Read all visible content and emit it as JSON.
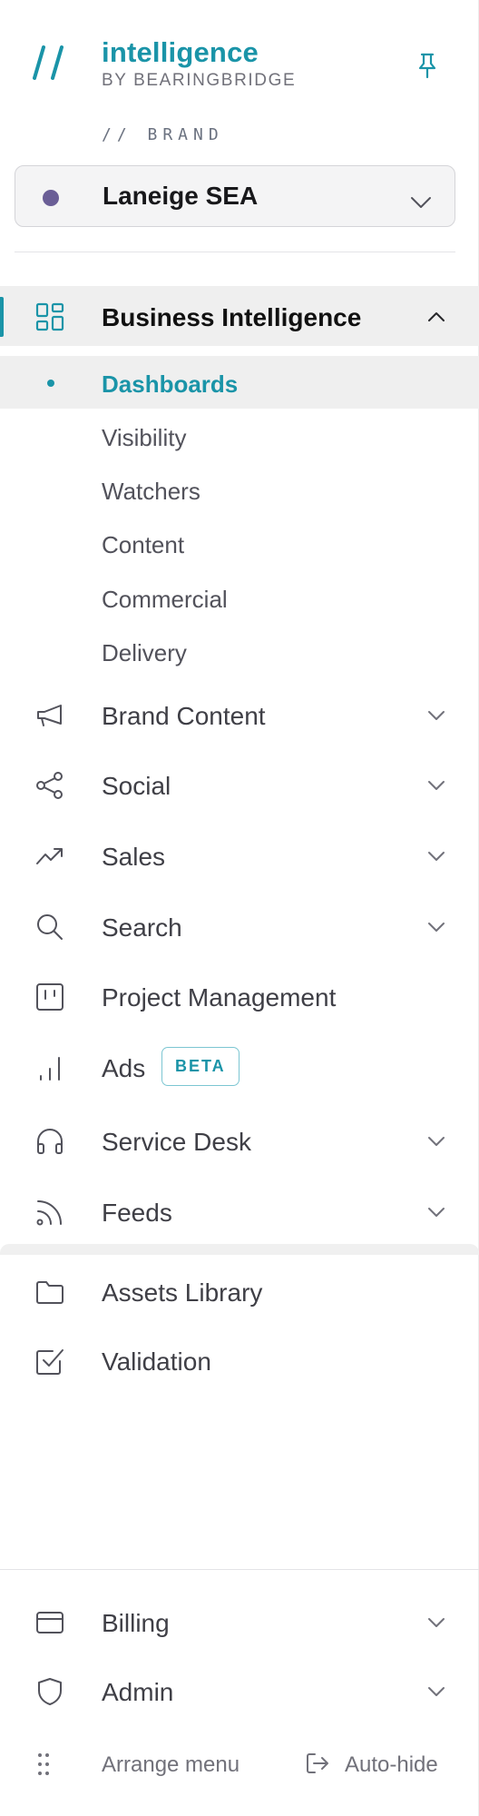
{
  "header": {
    "app_name": "intelligence",
    "app_sub": "BY BEARINGBRIDGE",
    "logo_glyph": "//",
    "accent_color": "#1a94a8"
  },
  "brand": {
    "label": "// BRAND",
    "selected": "Laneige SEA",
    "dot_color": "#6a5e96"
  },
  "nav": {
    "business_intelligence": {
      "label": "Business Intelligence",
      "icon": "grid-icon",
      "expanded": true,
      "children": [
        "Dashboards",
        "Visibility",
        "Watchers",
        "Content",
        "Commercial",
        "Delivery"
      ],
      "current": "Dashboards"
    },
    "brand_content": {
      "label": "Brand Content",
      "icon": "megaphone-icon"
    },
    "social": {
      "label": "Social",
      "icon": "share-icon"
    },
    "sales": {
      "label": "Sales",
      "icon": "trending-up-icon"
    },
    "search": {
      "label": "Search",
      "icon": "search-icon"
    },
    "project_management": {
      "label": "Project Management",
      "icon": "kanban-icon"
    },
    "ads": {
      "label": "Ads",
      "icon": "bar-chart-icon",
      "badge": "BETA"
    },
    "service_desk": {
      "label": "Service Desk",
      "icon": "headphones-icon"
    },
    "feeds": {
      "label": "Feeds",
      "icon": "rss-icon"
    },
    "assets_library": {
      "label": "Assets Library",
      "icon": "folder-icon"
    },
    "validation": {
      "label": "Validation",
      "icon": "checkbox-icon"
    },
    "billing": {
      "label": "Billing",
      "icon": "credit-card-icon"
    },
    "admin": {
      "label": "Admin",
      "icon": "shield-icon"
    }
  },
  "footer": {
    "arrange_label": "Arrange menu",
    "autohide_label": "Auto-hide"
  }
}
